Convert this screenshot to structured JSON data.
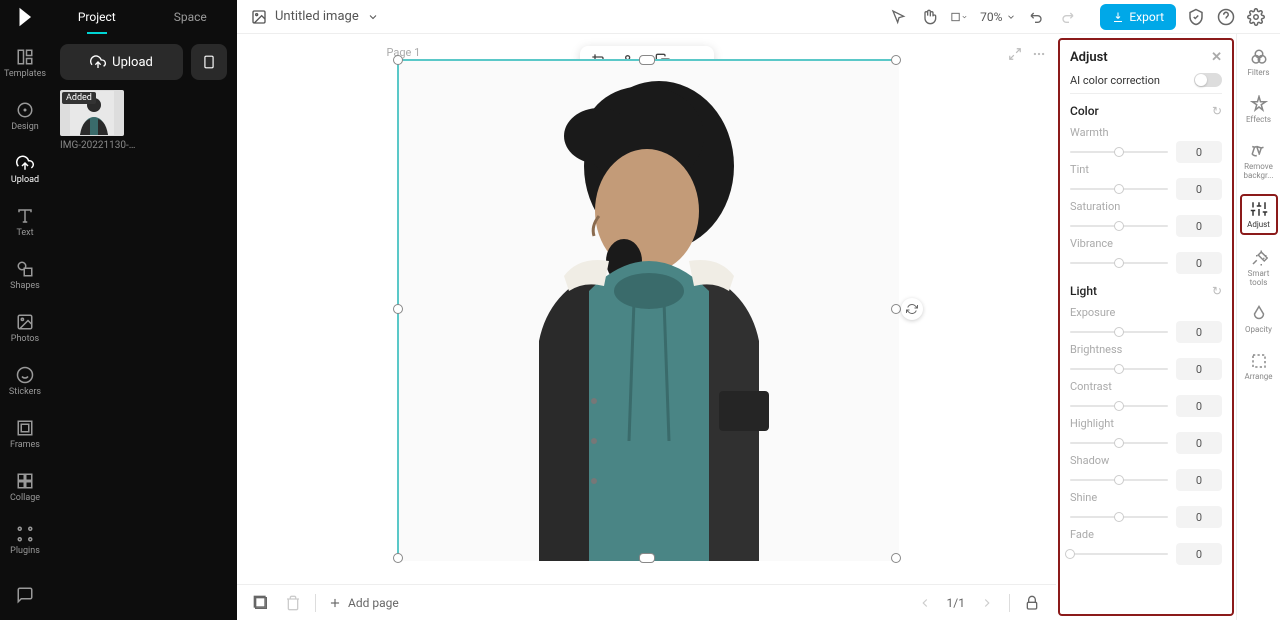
{
  "header": {
    "tabs": {
      "project": "Project",
      "space": "Space"
    },
    "title": "Untitled image",
    "zoom": "70%",
    "export": "Export"
  },
  "leftNav": {
    "templates": "Templates",
    "design": "Design",
    "upload": "Upload",
    "text": "Text",
    "shapes": "Shapes",
    "photos": "Photos",
    "stickers": "Stickers",
    "frames": "Frames",
    "collage": "Collage",
    "plugins": "Plugins"
  },
  "uploadPanel": {
    "uploadBtn": "Upload",
    "thumbBadge": "Added",
    "thumbName": "IMG-20221130-WA0..."
  },
  "canvas": {
    "pageLabel": "Page 1",
    "addPage": "Add page",
    "pageCount": "1/1"
  },
  "adjust": {
    "title": "Adjust",
    "aiColor": "AI color correction",
    "sections": {
      "color": {
        "title": "Color",
        "sliders": [
          {
            "label": "Warmth",
            "value": "0"
          },
          {
            "label": "Tint",
            "value": "0"
          },
          {
            "label": "Saturation",
            "value": "0"
          },
          {
            "label": "Vibrance",
            "value": "0"
          }
        ]
      },
      "light": {
        "title": "Light",
        "sliders": [
          {
            "label": "Exposure",
            "value": "0"
          },
          {
            "label": "Brightness",
            "value": "0"
          },
          {
            "label": "Contrast",
            "value": "0"
          },
          {
            "label": "Highlight",
            "value": "0"
          },
          {
            "label": "Shadow",
            "value": "0"
          },
          {
            "label": "Shine",
            "value": "0"
          },
          {
            "label": "Fade",
            "value": "0"
          }
        ]
      }
    }
  },
  "rightRail": {
    "filters": "Filters",
    "effects": "Effects",
    "removeBg": "Remove backgr...",
    "adjust": "Adjust",
    "smartTools": "Smart tools",
    "opacity": "Opacity",
    "arrange": "Arrange"
  }
}
